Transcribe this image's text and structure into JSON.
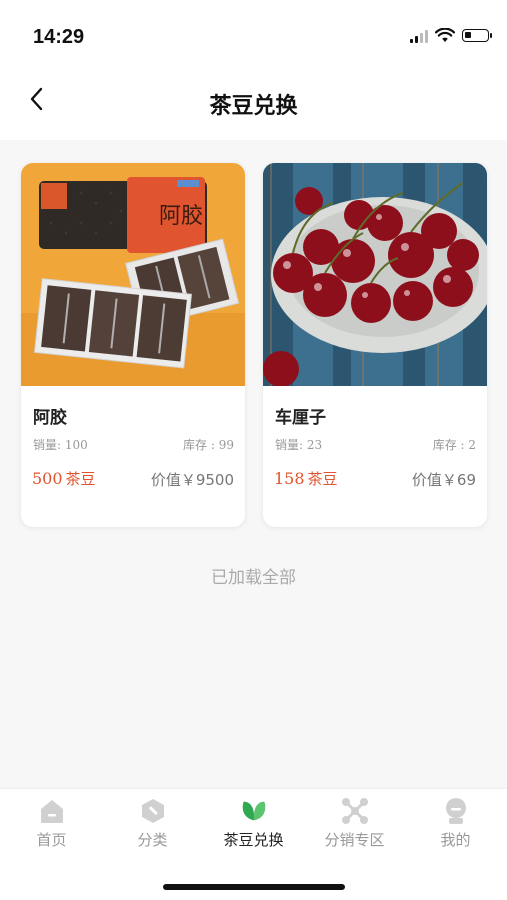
{
  "status_bar": {
    "time": "14:29"
  },
  "header": {
    "title": "茶豆兑换"
  },
  "products": [
    {
      "name": "阿胶",
      "sales": "销量: 100",
      "stock": "库存 : 99",
      "price_number": "500",
      "price_unit": "茶豆",
      "value": "价值￥9500",
      "image_icon": "ejiao-gift-box-image",
      "package_text": "阿胶"
    },
    {
      "name": "车厘子",
      "sales": "销量: 23",
      "stock": "库存 : 2",
      "price_number": "158",
      "price_unit": "茶豆",
      "value": "价值￥69",
      "image_icon": "cherries-plate-image"
    }
  ],
  "footer_text": "已加载全部",
  "tab_bar": {
    "tabs": [
      {
        "label": "首页",
        "icon": "home-icon",
        "active": false
      },
      {
        "label": "分类",
        "icon": "category-icon",
        "active": false
      },
      {
        "label": "茶豆兑换",
        "icon": "leaf-icon",
        "active": true
      },
      {
        "label": "分销专区",
        "icon": "share-network-icon",
        "active": false
      },
      {
        "label": "我的",
        "icon": "user-icon",
        "active": false
      }
    ]
  },
  "colors": {
    "accent_price": "#e0542f",
    "active_tab_icon": "#2fa84f",
    "inactive_tab_icon": "#d0d0d0",
    "background": "#f7f7f7"
  }
}
